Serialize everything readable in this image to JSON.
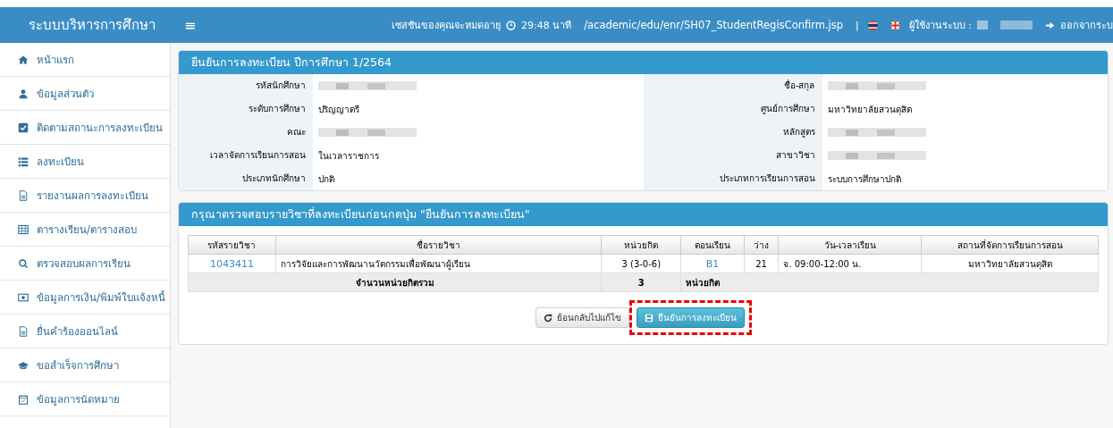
{
  "header": {
    "brand": "ระบบบริหารการศึกษา",
    "menu_toggle": "≡",
    "session_text": "เซสชันของคุณจะหมดอายุ",
    "timer": "29:48 นาที",
    "path": "/academic/edu/enr/SH07_StudentRegisConfirm.jsp",
    "separator": "|",
    "user_label": "ผู้ใช้งานระบบ :",
    "logout": "ออกจากระบ"
  },
  "sidebar": {
    "items": [
      {
        "label": "หน้าแรก",
        "kind": "home"
      },
      {
        "label": "ข้อมูลส่วนตัว",
        "kind": "user"
      },
      {
        "label": "ติดตามสถานะการลงทะเบียน",
        "kind": "check"
      },
      {
        "label": "ลงทะเบียน",
        "kind": "list"
      },
      {
        "label": "รายงานผลการลงทะเบียน",
        "kind": "file"
      },
      {
        "label": "ตารางเรียน/ตารางสอบ",
        "kind": "table"
      },
      {
        "label": "ตรวจสอบผลการเรียน",
        "kind": "search"
      },
      {
        "label": "ข้อมูลการเงิน/พิมพ์ใบแจ้งหนี้",
        "kind": "money"
      },
      {
        "label": "ยื่นคำร้องออนไลน์",
        "kind": "file"
      },
      {
        "label": "ขอสำเร็จการศึกษา",
        "kind": "cap"
      },
      {
        "label": "ข้อมูลการนัดหมาย",
        "kind": "calendar"
      }
    ]
  },
  "info_panel": {
    "title": "ยืนยันการลงทะเบียน ปีการศึกษา 1/2564",
    "left": [
      {
        "label": "รหัสนักศึกษา"
      },
      {
        "label": "ระดับการศึกษา",
        "value": "ปริญญาตรี"
      },
      {
        "label": "คณะ"
      },
      {
        "label": "เวลาจัดการเรียนการสอน",
        "value": "ในเวลาราชการ"
      },
      {
        "label": "ประเภทนักศึกษา",
        "value": "ปกติ"
      }
    ],
    "right": [
      {
        "label": "ชื่อ-สกุล"
      },
      {
        "label": "ศูนย์การศึกษา",
        "value": "มหาวิทยาลัยสวนดุสิต"
      },
      {
        "label": "หลักสูตร"
      },
      {
        "label": "สาขาวิชา"
      },
      {
        "label": "ประเภทการเรียนการสอน",
        "value": "ระบบการศึกษาปกติ"
      }
    ]
  },
  "course_panel": {
    "title": "กรุณาตรวจสอบรายวิชาที่ลงทะเบียนก่อนกดปุ่ม \"ยืนยันการลงทะเบียน\"",
    "columns": [
      "รหัสรายวิชา",
      "ชื่อรายวิชา",
      "หน่วยกิต",
      "ตอนเรียน",
      "ว่าง",
      "วัน-เวลาเรียน",
      "สถานที่จัดการเรียนการสอน"
    ],
    "rows": [
      {
        "code": "1043411",
        "name": "การวิจัยและการพัฒนานวัตกรรมเพื่อพัฒนาผู้เรียน",
        "credits": "3 (3-0-6)",
        "section": "B1",
        "seats": "21",
        "time": "จ. 09:00-12:00 น.",
        "place": "มหาวิทยาลัยสวนดุสิต"
      }
    ],
    "total": {
      "label": "จำนวนหน่วยกิตรวม",
      "credits": "3",
      "unit": "หน่วยกิต"
    },
    "back_button": "ย้อนกลับไปแก้ไข",
    "confirm_button": "ยืนยันการลงทะเบียน",
    "confirm_highlighted": true
  }
}
